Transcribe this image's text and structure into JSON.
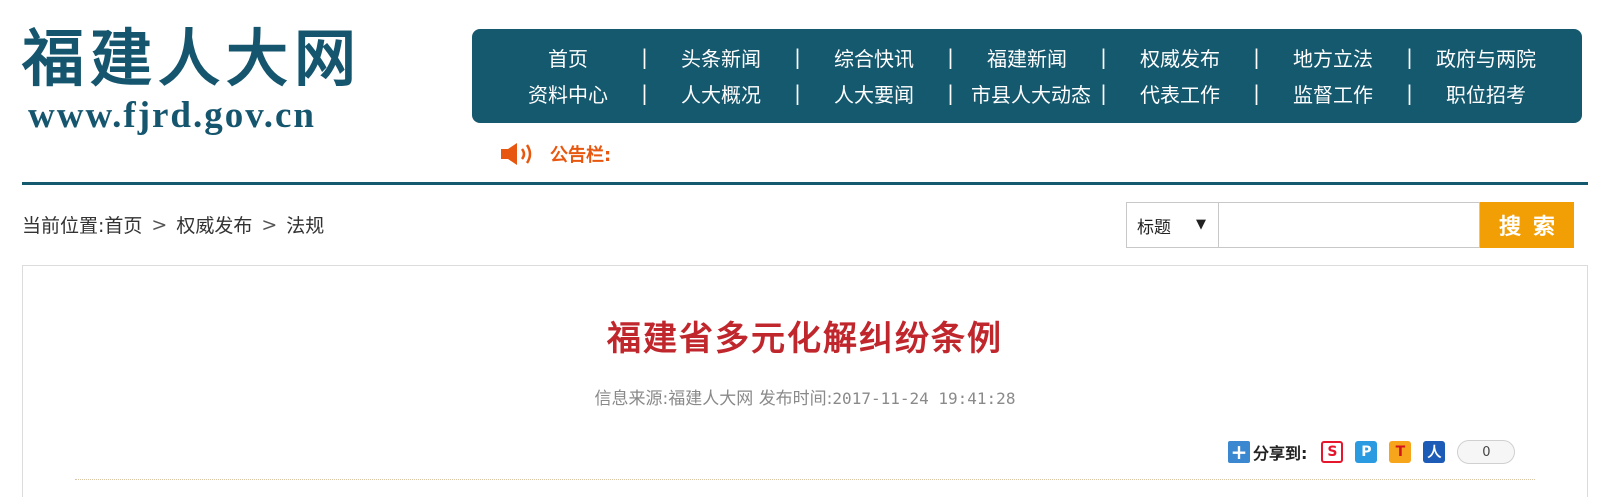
{
  "logo": {
    "name": "福建人大网",
    "url": "www.fjrd.gov.cn"
  },
  "nav": {
    "row1": [
      "首页",
      "头条新闻",
      "综合快讯",
      "福建新闻",
      "权威发布",
      "地方立法",
      "政府与两院"
    ],
    "row2": [
      "资料中心",
      "人大概况",
      "人大要闻",
      "市县人大动态",
      "代表工作",
      "监督工作",
      "职位招考"
    ],
    "separator": "|"
  },
  "bulletin": {
    "label": "公告栏:",
    "icon": "speaker-icon"
  },
  "breadcrumb": {
    "prefix": "当前位置:",
    "items": [
      "首页",
      "权威发布",
      "法规"
    ],
    "separator": ">"
  },
  "search": {
    "select_value": "标题",
    "select_arrow": "▼",
    "input_value": "",
    "button_label": "搜索"
  },
  "article": {
    "title": "福建省多元化解纠纷条例",
    "source_label": "信息来源:",
    "source": "福建人大网",
    "time_label": "发布时间:",
    "time": "2017-11-24 19:41:28"
  },
  "share": {
    "label": "分享到:",
    "count": "0",
    "icons": [
      "weibo-icon",
      "qzone-icon",
      "tencent-weibo-icon",
      "renren-icon"
    ]
  },
  "colors": {
    "brand": "#15596f",
    "title_red": "#c0272d",
    "search_button": "#f29f05",
    "bulletin_orange": "#e8570f"
  }
}
